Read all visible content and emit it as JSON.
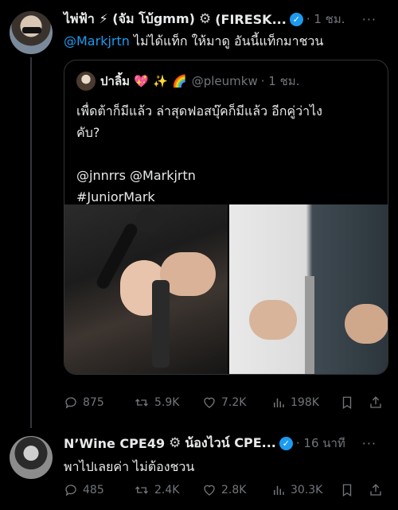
{
  "tweet1": {
    "display_name": "ไพ่ฟ้า ⚡ (จัม โบ้gmm)",
    "name_suffix": "(FIRESK...",
    "time": "· 1 ชม.",
    "mention": "@Markjrtn",
    "text": " ไม่ได้แท็ก ให้มาดู อันนี้แท็กมาชวน",
    "quote": {
      "display_name": "ปาลิ้ม 💖 ✨ 🌈",
      "handle": "@pleumkw",
      "time": "· 1 ชม.",
      "line1": "เพื่ดต้าก็มีแล้ว ล่าสุดฟอสบุ๊คก็มีแล้ว อีกคู่ว่าไง",
      "line2": "คับ?",
      "line3": "@jnnrrs @Markjrtn",
      "line4": "#JuniorMark"
    },
    "stats": {
      "replies": "875",
      "retweets": "5.9K",
      "likes": "7.2K",
      "views": "198K"
    }
  },
  "tweet2": {
    "display_name": "N’Wine CPE49",
    "name_suffix": "น้องไวน์ CPE...",
    "time": "· 16 นาที",
    "text": "พาไปเลยค่า ไม่ต้องชวน",
    "stats": {
      "replies": "485",
      "retweets": "2.4K",
      "likes": "2.8K",
      "views": "30.3K"
    }
  },
  "icons": {
    "more": "more-icon",
    "verified": "verified-badge-icon",
    "gear": "gear-icon",
    "reply": "reply-icon",
    "retweet": "retweet-icon",
    "like": "heart-icon",
    "views": "views-icon",
    "bookmark": "bookmark-icon",
    "share": "share-icon"
  },
  "colors": {
    "accent": "#1d9bf0",
    "muted": "#71767b",
    "text": "#e7e9ea",
    "background": "#000000"
  }
}
